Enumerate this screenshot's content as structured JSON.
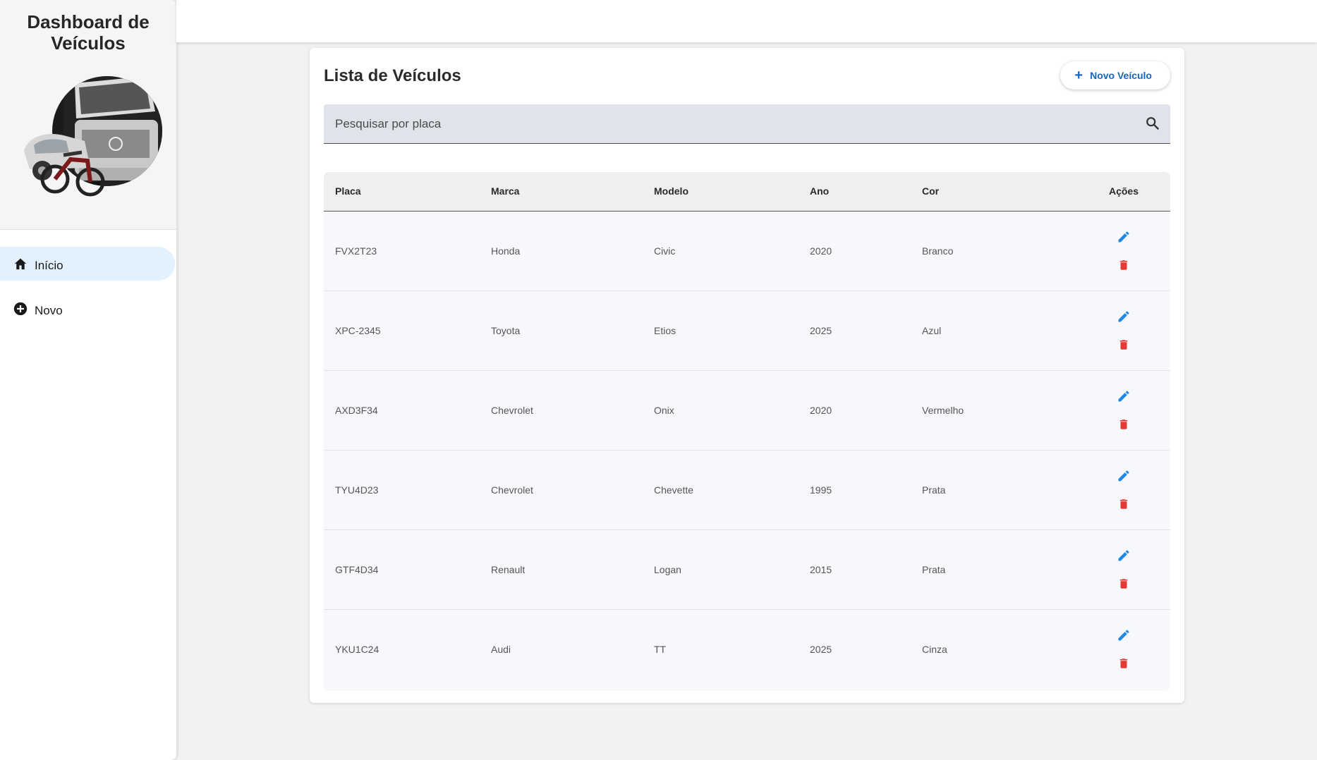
{
  "sidebar": {
    "title": "Dashboard de Veículos",
    "nav": [
      {
        "label": "Início",
        "icon": "home-icon",
        "active": true
      },
      {
        "label": "Novo",
        "icon": "add-circle-icon",
        "active": false
      }
    ]
  },
  "main": {
    "title": "Lista de Veículos",
    "new_button_label": "Novo Veículo",
    "search": {
      "placeholder": "Pesquisar por placa",
      "value": ""
    },
    "table": {
      "headers": [
        "Placa",
        "Marca",
        "Modelo",
        "Ano",
        "Cor",
        "Ações"
      ],
      "rows": [
        [
          "FVX2T23",
          "Honda",
          "Civic",
          "2020",
          "Branco"
        ],
        [
          "XPC-2345",
          "Toyota",
          "Etios",
          "2025",
          "Azul"
        ],
        [
          "AXD3F34",
          "Chevrolet",
          "Onix",
          "2020",
          "Vermelho"
        ],
        [
          "TYU4D23",
          "Chevrolet",
          "Chevette",
          "1995",
          "Prata"
        ],
        [
          "GTF4D34",
          "Renault",
          "Logan",
          "2015",
          "Prata"
        ],
        [
          "YKU1C24",
          "Audi",
          "TT",
          "2025",
          "Cinza"
        ]
      ]
    }
  },
  "colors": {
    "accent": "#1565c0",
    "edit": "#1e88e5",
    "delete": "#e53935",
    "nav_active_bg": "#e3f0fd"
  }
}
